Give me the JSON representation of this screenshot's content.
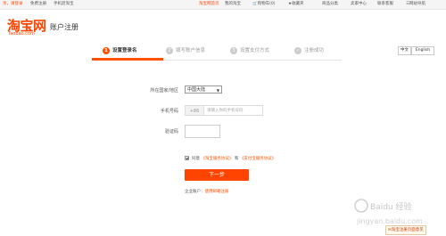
{
  "topbar": {
    "greeting": "亲，请登录",
    "free_register": "免费注册",
    "mobile": "手机逛淘宝",
    "home": "淘宝网首页",
    "my_taobao": "我的淘宝",
    "cart": "购物车(0)",
    "favorites": "收藏夹",
    "products": "商品分类",
    "seller_center": "卖家中心",
    "contact": "联系客服",
    "site_nav": "网站导航"
  },
  "logo": {
    "main": "淘宝网",
    "sub": "Taobao.com"
  },
  "page_title": "账户注册",
  "steps": [
    {
      "num": "1",
      "label": "设置登录名"
    },
    {
      "num": "2",
      "label": "填写账户信息"
    },
    {
      "num": "3",
      "label": "设置支付方式"
    },
    {
      "num": "✓",
      "label": "注册成功"
    }
  ],
  "lang": {
    "zh": "中文",
    "en": "English"
  },
  "form": {
    "country_label": "所在国家/地区",
    "country_value": "中国大陆",
    "phone_label": "手机号码",
    "phone_prefix": "+86",
    "phone_placeholder": "请输入你的手机号码",
    "captcha_label": "验证码"
  },
  "agreement": {
    "agree": "同意",
    "link1": "《淘宝服务协议》",
    "and": "和",
    "link2": "《支付宝服务协议》"
  },
  "next_button": "下一步",
  "enterprise": {
    "text": "企业账户：",
    "link": "使用邮箱注册"
  },
  "feedback": "淘宝注册页面意见",
  "watermark": {
    "title": "Baidu 经验",
    "url": "jingyan.baidu.com"
  },
  "colors": {
    "brand": "#ff4400",
    "step_active": "#ff5000"
  }
}
